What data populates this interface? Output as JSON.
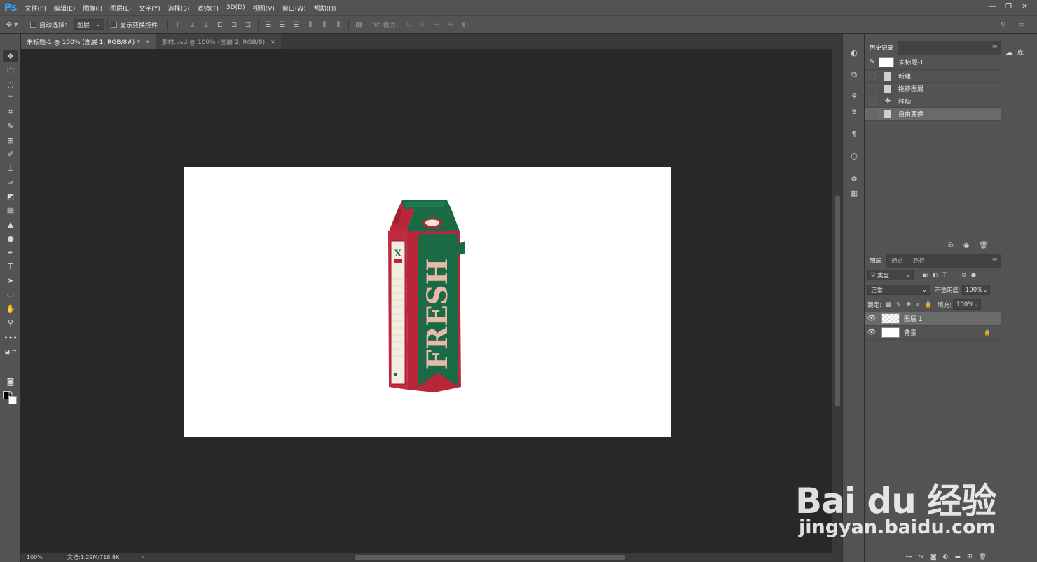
{
  "app": {
    "logo": "Ps"
  },
  "menu": [
    "文件(F)",
    "编辑(E)",
    "图像(I)",
    "图层(L)",
    "文字(Y)",
    "选择(S)",
    "滤镜(T)",
    "3D(D)",
    "视图(V)",
    "窗口(W)",
    "帮助(H)"
  ],
  "window_controls": {
    "minimize": "—",
    "restore": "❐",
    "close": "✕"
  },
  "options": {
    "auto_select_label": "自动选择：",
    "auto_select_value": "图层",
    "show_transform_label": "显示变换控件",
    "mode_3d_label": "3D 模式："
  },
  "tabs": [
    {
      "label": "未标题-1 @ 100% (图层 1, RGB/8#) *",
      "close": "×"
    },
    {
      "label": "素材.psd @ 100% (图层 2, RGB/8)",
      "close": "×"
    }
  ],
  "status": {
    "zoom": "100%",
    "doc_info": "文档:1.29M/718.8K",
    "arrow": "›"
  },
  "history_panel": {
    "tab": "历史记录",
    "menu": "≡",
    "snapshot": "未标题-1",
    "steps": [
      "新建",
      "拖移图层",
      "移动",
      "自由变换"
    ],
    "selected_index": 3
  },
  "layers_panel": {
    "tabs": [
      "图层",
      "通道",
      "路径"
    ],
    "filter_kind": "类型",
    "blend_mode": "正常",
    "opacity_label": "不透明度:",
    "opacity_value": "100%",
    "lock_label": "锁定:",
    "fill_label": "填充:",
    "fill_value": "100%",
    "layers": [
      {
        "name": "图层 1",
        "selected": true,
        "thumb": "transparent"
      },
      {
        "name": "背景",
        "selected": false,
        "thumb": "white",
        "locked": true
      }
    ],
    "footer_fx": "fx"
  },
  "library": {
    "label": "库"
  },
  "product": {
    "brand_text": "FRESH",
    "logo_letter": "X"
  },
  "watermark": {
    "brand": "Bai du 经验",
    "url": "jingyan.baidu.com"
  },
  "colors": {
    "accent": "#31a8ff",
    "carton_red": "#b8263a",
    "carton_green": "#1a6b45",
    "fresh_letters": "#e8b9a8"
  }
}
